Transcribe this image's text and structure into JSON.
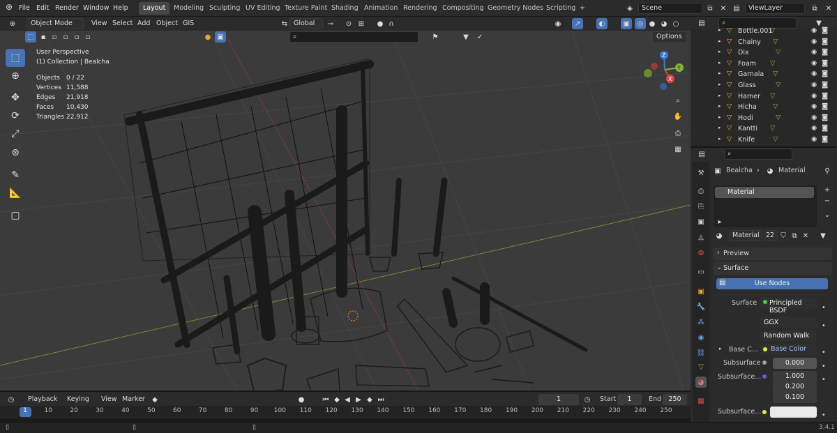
{
  "topbar": {
    "menu": [
      "File",
      "Edit",
      "Render",
      "Window",
      "Help"
    ],
    "workspaces": [
      "Layout",
      "Modeling",
      "Sculpting",
      "UV Editing",
      "Texture Paint",
      "Shading",
      "Animation",
      "Rendering",
      "Compositing",
      "Geometry Nodes",
      "Scripting"
    ],
    "active_workspace": "Layout",
    "add_workspace": "+",
    "scene": "Scene",
    "view_layer": "ViewLayer"
  },
  "viewport_header": {
    "mode": "Object Mode",
    "menus": [
      "View",
      "Select",
      "Add",
      "Object",
      "GIS"
    ],
    "orientation": "Global",
    "options": "Options"
  },
  "overlay_text": {
    "perspective": "User Perspective",
    "collection": "(1) Collection | Bealcha",
    "stats": [
      {
        "label": "Objects",
        "value": "0 / 22"
      },
      {
        "label": "Vertices",
        "value": "11,588"
      },
      {
        "label": "Edges",
        "value": "21,918"
      },
      {
        "label": "Faces",
        "value": "10,430"
      },
      {
        "label": "Triangles",
        "value": "22,912"
      }
    ]
  },
  "gizmo": {
    "z": "Z",
    "y": "Y",
    "x": "X"
  },
  "timeline": {
    "menus": [
      "Playback",
      "Keying",
      "View",
      "Marker"
    ],
    "current_frame": "1",
    "start_label": "Start",
    "start": "1",
    "end_label": "End",
    "end": "250",
    "ticks": [
      "1",
      "10",
      "20",
      "30",
      "40",
      "50",
      "60",
      "70",
      "80",
      "90",
      "100",
      "110",
      "120",
      "130",
      "140",
      "150",
      "160",
      "170",
      "180",
      "190",
      "200",
      "210",
      "220",
      "230",
      "240",
      "250"
    ]
  },
  "outliner": {
    "items": [
      "Bottle.001",
      "Chainy",
      "Dix",
      "Foam",
      "Garnala",
      "Glass",
      "Hamer",
      "Hicha",
      "Hodi",
      "Kantti",
      "Knife"
    ]
  },
  "properties": {
    "object": "Bealcha",
    "material_crumb": "Material",
    "slot": "Material",
    "material_name": "Material",
    "users": "22",
    "preview": "Preview",
    "surface_panel": "Surface",
    "use_nodes": "Use Nodes",
    "surface_label": "Surface",
    "surface_value": "Principled BSDF",
    "distribution": "GGX",
    "subsurface_method": "Random Walk",
    "base_color_label": "Base C...",
    "base_color_value": "Base Color",
    "subsurface_label": "Subsurface",
    "subsurface_value": "0.000",
    "subsurface_radius_label": "Subsurface...",
    "radius": [
      "1.000",
      "0.200",
      "0.100"
    ],
    "subsurface_color_label": "Subsurface..."
  },
  "status": {
    "version": "3.4.1"
  },
  "colors": {
    "accent": "#4772b3",
    "grid_x": "#c0504d",
    "grid_y": "#8ab33a",
    "viewport": "#3b3b3b"
  }
}
